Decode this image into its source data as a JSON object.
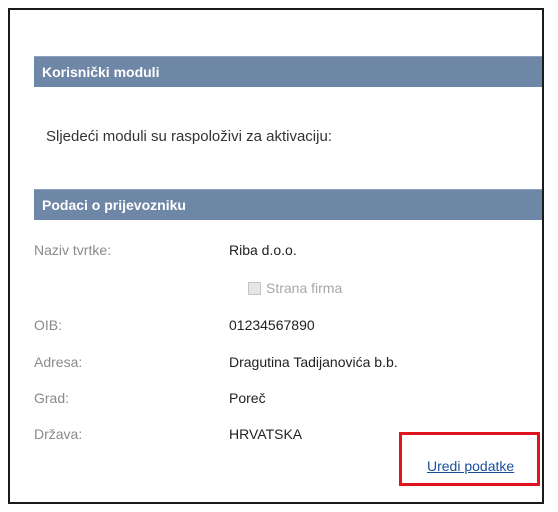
{
  "modules": {
    "header": "Korisnički moduli",
    "intro": "Sljedeći moduli su raspoloživi za aktivaciju:"
  },
  "carrier": {
    "header": "Podaci o prijevozniku",
    "company_label": "Naziv tvrtke:",
    "company_value": "Riba d.o.o.",
    "foreign_checkbox_label": "Strana firma",
    "foreign_checked": false,
    "oib_label": "OIB:",
    "oib_value": "01234567890",
    "address_label": "Adresa:",
    "address_value": "Dragutina Tadijanovića b.b.",
    "city_label": "Grad:",
    "city_value": "Poreč",
    "country_label": "Država:",
    "country_value": "HRVATSKA",
    "edit_link": "Uredi podatke"
  },
  "colors": {
    "header_bg": "#6f87a6",
    "link": "#1a4f9c",
    "highlight": "#e0141e"
  }
}
